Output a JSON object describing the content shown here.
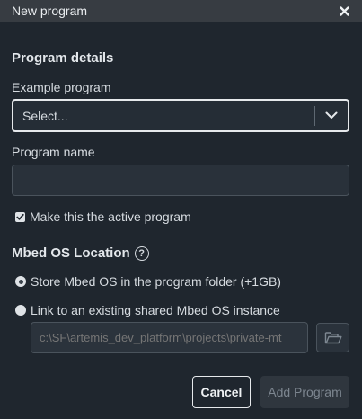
{
  "dialog": {
    "title": "New program"
  },
  "program_details": {
    "heading": "Program details",
    "example_label": "Example program",
    "example_selected": "Select...",
    "name_label": "Program name",
    "name_value": "",
    "active_checkbox_label": "Make this the active program",
    "active_checked": true
  },
  "mbed_os": {
    "heading": "Mbed OS Location",
    "help_glyph": "?",
    "option_store_label": "Store Mbed OS in the program folder (+1GB)",
    "option_link_label": "Link to an existing shared Mbed OS instance",
    "selected_option": "store",
    "shared_path_placeholder": "c:\\SF\\artemis_dev_platform\\projects\\private-mt"
  },
  "footer": {
    "cancel_label": "Cancel",
    "add_label": "Add Program"
  },
  "icons": {
    "close": "close-icon",
    "chevron": "chevron-down-icon",
    "check": "check-icon",
    "help": "question-circle-icon",
    "folder": "folder-open-icon"
  },
  "colors": {
    "background": "#1f262e",
    "titlebar": "#373c42",
    "text": "#d6dbe0",
    "disabled_text": "#7d8690"
  }
}
